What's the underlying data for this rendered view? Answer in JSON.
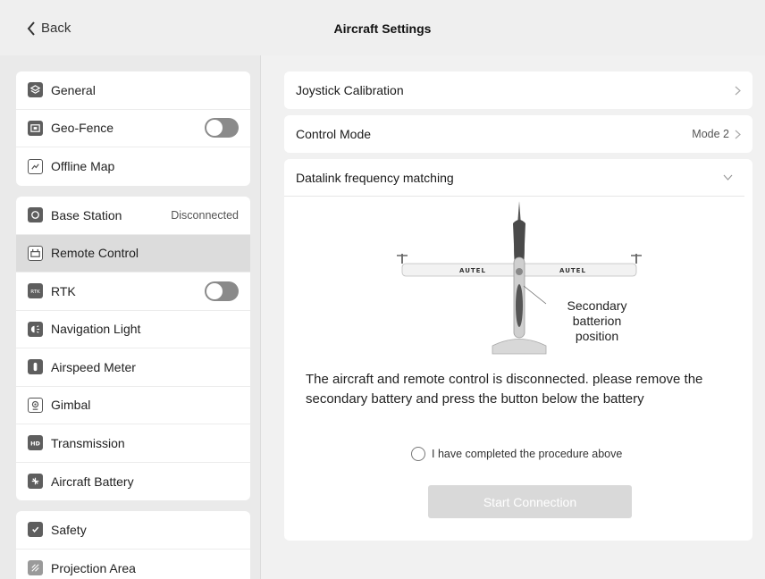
{
  "header": {
    "back_label": "Back",
    "title": "Aircraft Settings"
  },
  "sidebar": {
    "group1": [
      {
        "label": "General",
        "icon": "layers-icon"
      },
      {
        "label": "Geo-Fence",
        "icon": "map-icon",
        "toggle": "off"
      },
      {
        "label": "Offline Map",
        "icon": "map-download-icon"
      }
    ],
    "group2": [
      {
        "label": "Base Station",
        "icon": "base-station-icon",
        "status": "Disconnected"
      },
      {
        "label": "Remote Control",
        "icon": "remote-control-icon",
        "active": true
      },
      {
        "label": "RTK",
        "icon": "rtk-icon",
        "toggle": "off"
      },
      {
        "label": "Navigation Light",
        "icon": "light-icon"
      },
      {
        "label": "Airspeed Meter",
        "icon": "airspeed-icon"
      },
      {
        "label": "Gimbal",
        "icon": "gimbal-icon"
      },
      {
        "label": "Transmission",
        "icon": "hd-icon"
      },
      {
        "label": "Aircraft Battery",
        "icon": "battery-icon"
      }
    ],
    "group3": [
      {
        "label": "Safety",
        "icon": "shield-check-icon"
      },
      {
        "label": "Projection Area",
        "icon": "projection-icon"
      }
    ]
  },
  "main": {
    "joystick_label": "Joystick Calibration",
    "control_mode_label": "Control Mode",
    "control_mode_value": "Mode 2",
    "datalink_label": "Datalink frequency matching",
    "drone_brand_left": "AUTEL",
    "drone_brand_right": "AUTEL",
    "battery_label_line1": "Secondary",
    "battery_label_line2": "batterion",
    "battery_label_line3": "position",
    "message": "The aircraft and remote control is disconnected. please remove the secondary battery and press the button below the battery",
    "checkbox_label": "I have completed the procedure above",
    "button_label": "Start Connection"
  },
  "colors": {
    "active_bg": "#dcdcdc",
    "disabled_button": "#d9d9d9",
    "toggle_off": "#8a8a8a"
  }
}
